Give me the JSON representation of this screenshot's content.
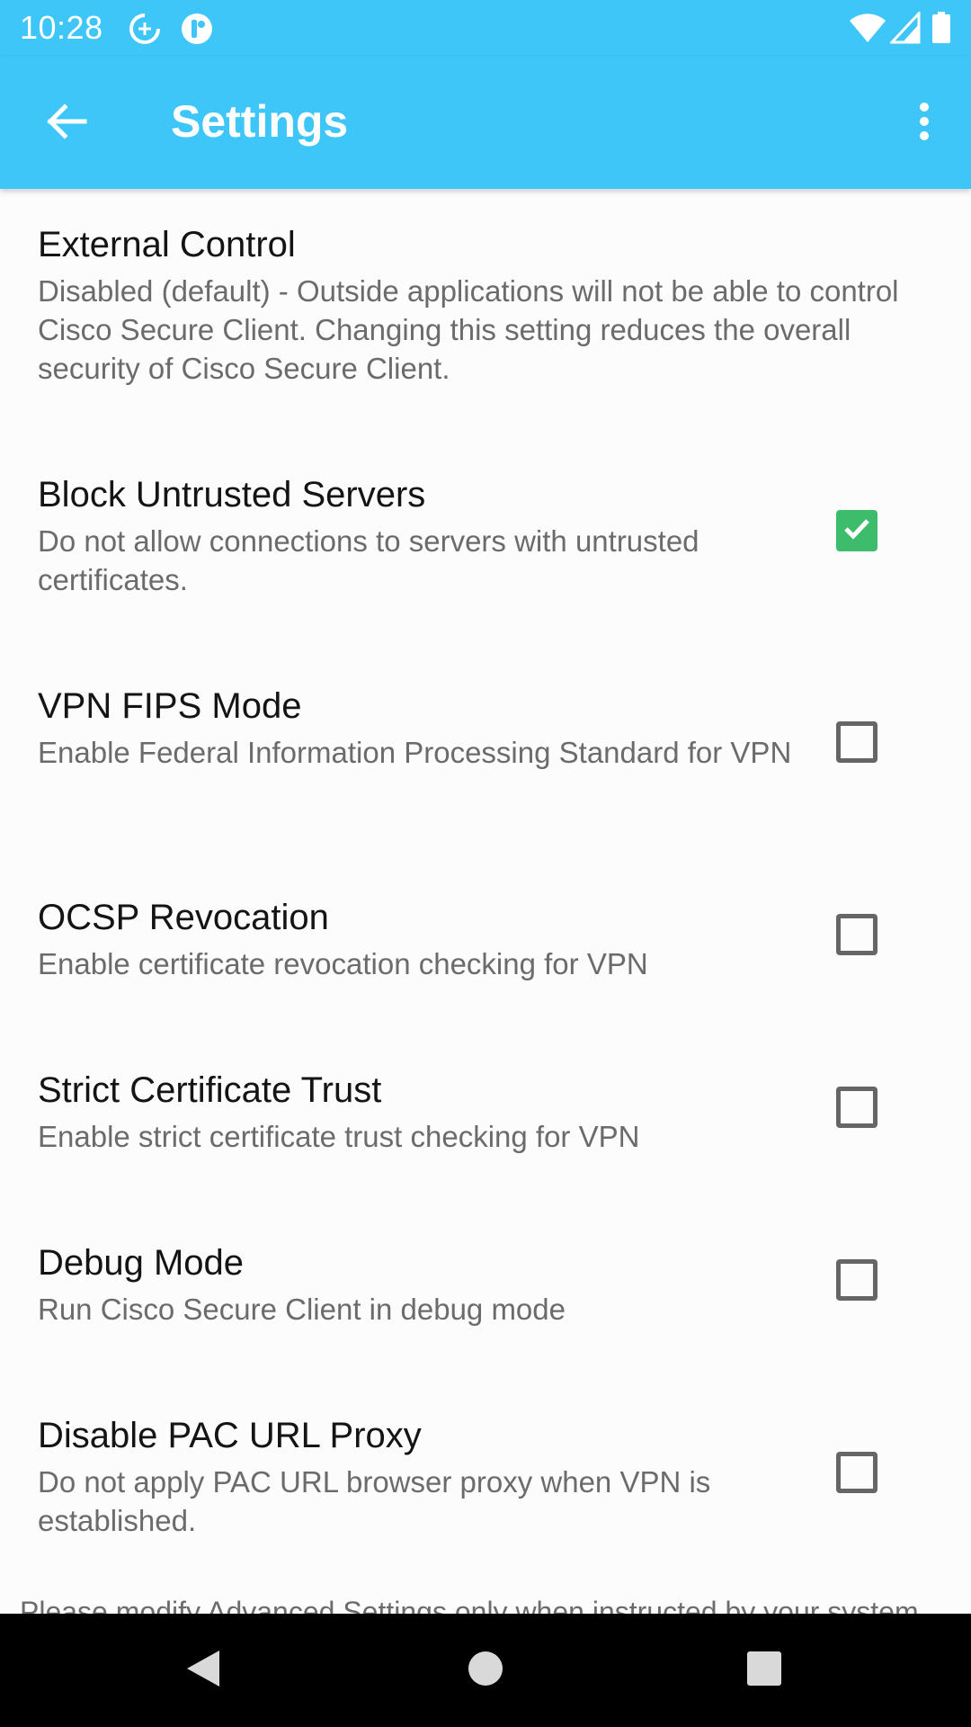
{
  "status_bar": {
    "time": "10:28",
    "icons": [
      "data-saver-icon",
      "notification-app-icon",
      "wifi-icon",
      "cell-signal-icon",
      "battery-icon"
    ]
  },
  "app_bar": {
    "title": "Settings",
    "back_icon": "arrow-back-icon",
    "menu_icon": "more-vert-icon"
  },
  "preferences": [
    {
      "title": "External Control",
      "summary": "Disabled (default) - Outside applications will not be able to control Cisco Secure Client. Changing this setting reduces the overall security of Cisco Secure Client."
    },
    {
      "title": "Block Untrusted Servers",
      "summary": "Do not allow connections to servers with untrusted certificates.",
      "checked": true
    },
    {
      "title": "VPN FIPS Mode",
      "summary": "Enable Federal Information Processing Standard for VPN",
      "checked": false
    },
    {
      "title": "OCSP Revocation",
      "summary": "Enable certificate revocation checking for VPN",
      "checked": false
    },
    {
      "title": "Strict Certificate Trust",
      "summary": "Enable strict certificate trust checking for VPN",
      "checked": false
    },
    {
      "title": "Debug Mode",
      "summary": "Run Cisco Secure Client in debug mode",
      "checked": false
    },
    {
      "title": "Disable PAC URL Proxy",
      "summary": "Do not apply PAC URL browser proxy when VPN is established.",
      "checked": false
    }
  ],
  "footer_note": "Please modify Advanced Settings only when instructed by your system",
  "colors": {
    "accent": "#3ec6f8",
    "checkbox_checked": "#3dbd6c",
    "title_text": "#141414",
    "summary_text": "#6b6b6b"
  },
  "nav_bar": {
    "icons": [
      "nav-back-icon",
      "nav-home-icon",
      "nav-recents-icon"
    ]
  }
}
